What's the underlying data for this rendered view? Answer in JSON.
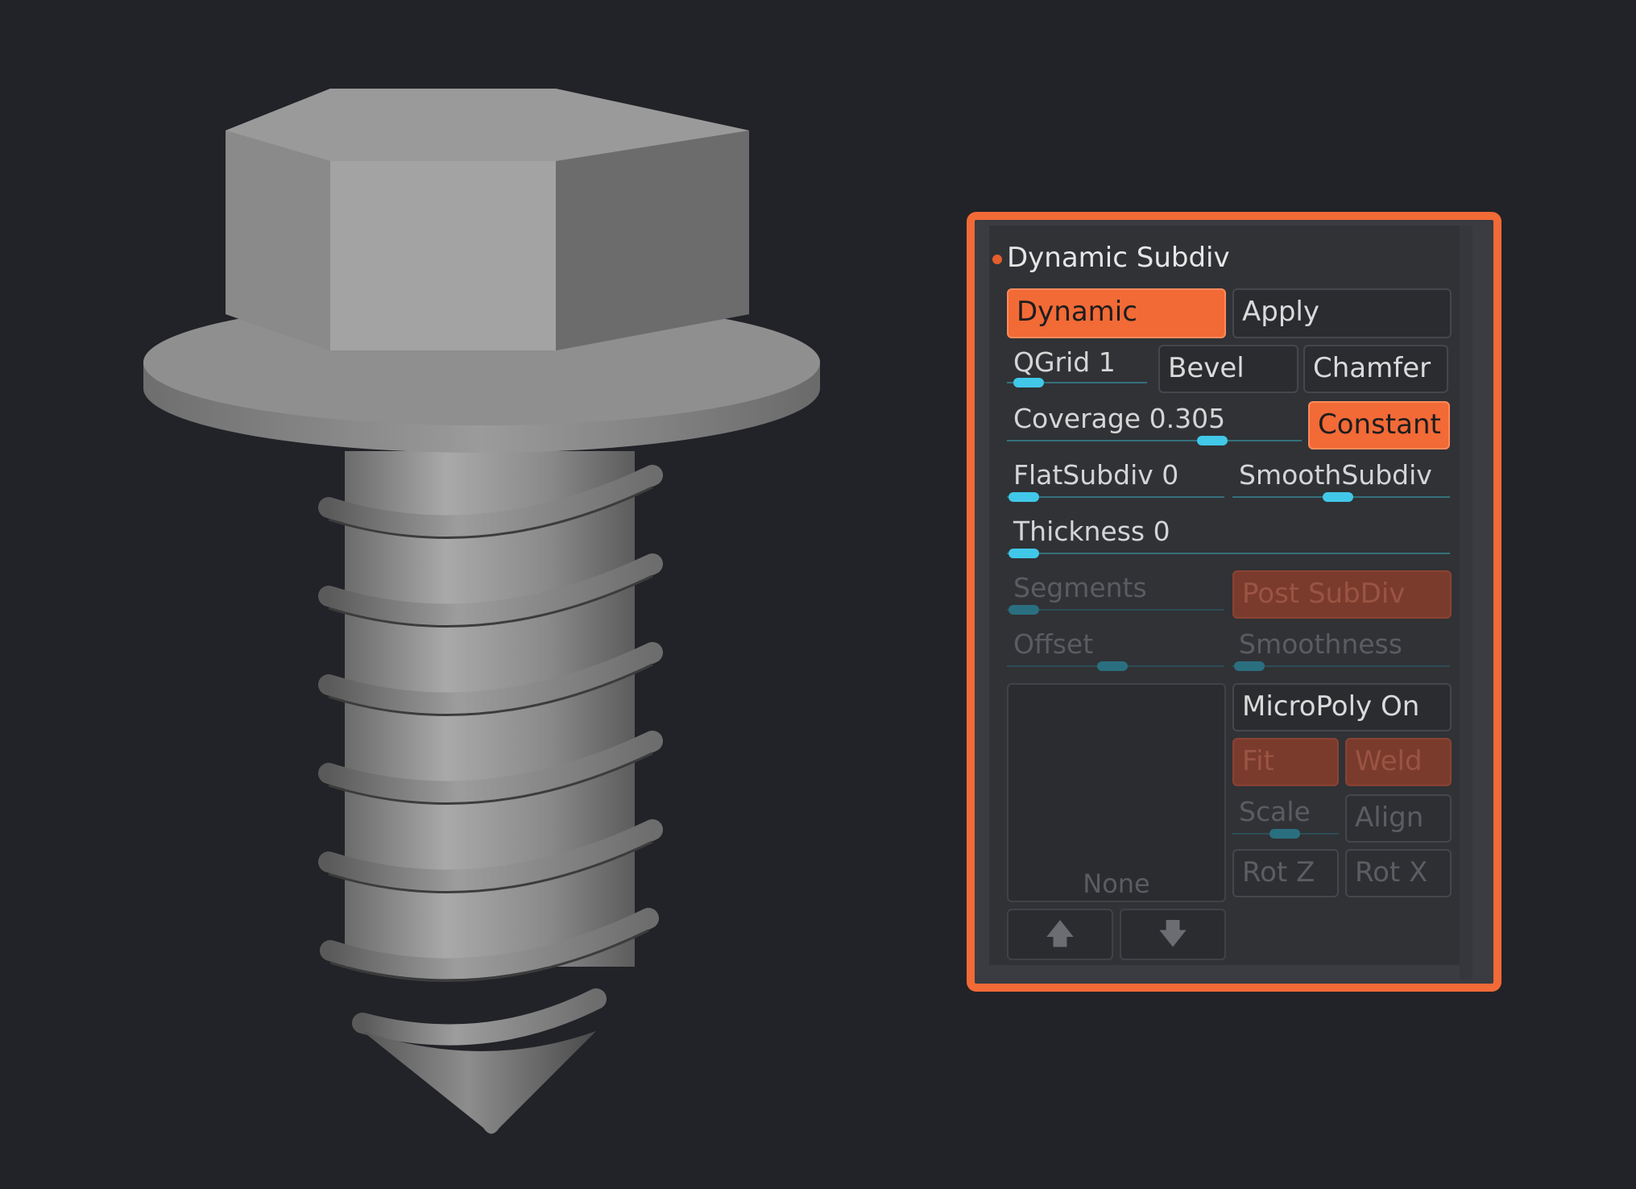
{
  "panel": {
    "title": "Dynamic Subdiv",
    "dynamic_label": "Dynamic",
    "apply_label": "Apply",
    "qgrid_label": "QGrid",
    "qgrid_value": "1",
    "bevel_label": "Bevel",
    "chamfer_label": "Chamfer",
    "coverage_label": "Coverage",
    "coverage_value": "0.305",
    "constant_label": "Constant",
    "flatsubdiv_label": "FlatSubdiv",
    "flatsubdiv_value": "0",
    "smoothsubdiv_label": "SmoothSubdiv",
    "thickness_label": "Thickness",
    "thickness_value": "0",
    "segments_label": "Segments",
    "postsubdiv_label": "Post SubDiv",
    "offset_label": "Offset",
    "smoothness_label": "Smoothness",
    "micropoly_label": "MicroPoly On",
    "texture_none_label": "None",
    "fit_label": "Fit",
    "weld_label": "Weld",
    "scale_label": "Scale",
    "align_label": "Align",
    "rotz_label": "Rot Z",
    "rotx_label": "Rot X",
    "up_arrow": "🡅",
    "down_arrow": "🡇"
  },
  "colors": {
    "accent": "#f26a36",
    "background": "#222328",
    "slider_knob": "#41c8e8"
  },
  "icons": {
    "up": "arrow-up-icon",
    "down": "arrow-down-icon"
  }
}
